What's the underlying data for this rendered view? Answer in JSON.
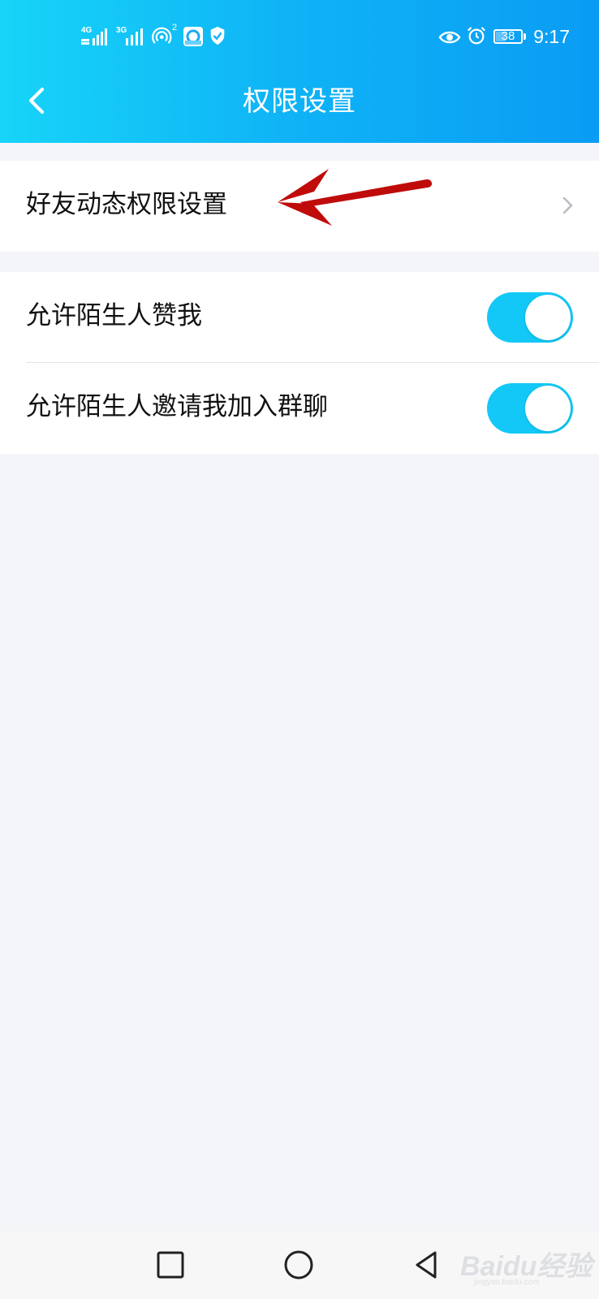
{
  "status_bar": {
    "network_1": "4G",
    "network_2": "3G",
    "hotspot_badge": "2",
    "battery_level": "38",
    "time": "9:17",
    "icons": [
      "signal-icon",
      "signal-icon",
      "hotspot-icon",
      "app-icon",
      "shield-icon",
      "eye-icon",
      "alarm-icon",
      "battery-icon"
    ]
  },
  "header": {
    "title": "权限设置",
    "back_icon": "chevron-left-icon"
  },
  "sections": {
    "friends_feed": {
      "label": "好友动态权限设置",
      "icon": "chevron-right-icon"
    },
    "allow_stranger_like": {
      "label": "允许陌生人赞我",
      "enabled": true
    },
    "allow_stranger_group_invite": {
      "label": "允许陌生人邀请我加入群聊",
      "enabled": true
    }
  },
  "system_nav": {
    "icons": [
      "recent-apps-icon",
      "home-icon",
      "back-icon"
    ]
  },
  "watermark": {
    "text": "Baidu经验",
    "sub": "jingyan.baidu.com"
  },
  "colors": {
    "header_gradient_start": "#17d4f8",
    "header_gradient_end": "#0a9cf4",
    "toggle_on": "#13c8f6",
    "annotation_arrow": "#c00b0b",
    "background": "#f4f5f9"
  }
}
